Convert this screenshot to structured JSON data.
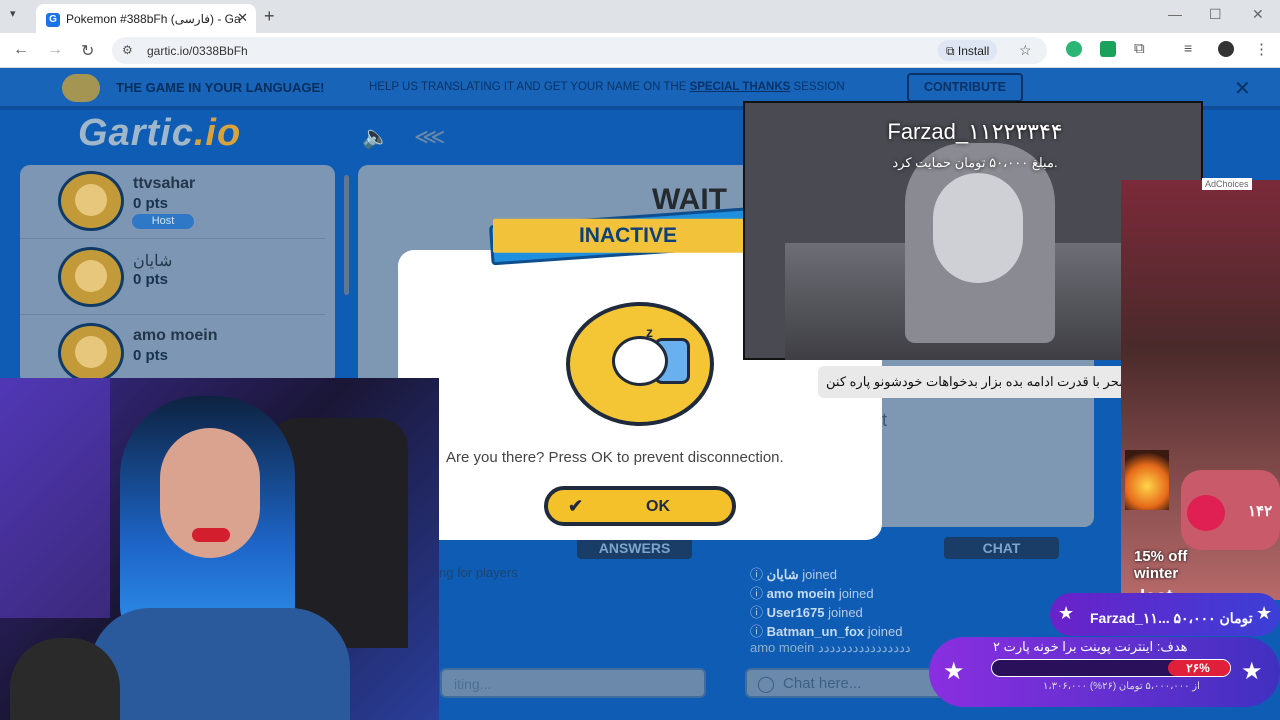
{
  "browser": {
    "tab_title": "Pokemon #388bFh (فارسی) - Ga",
    "url": "gartic.io/0338BbFh",
    "install_label": "Install"
  },
  "banner": {
    "headline": "THE GAME IN YOUR LANGUAGE!",
    "help_prefix": "HELP US TRANSLATING IT AND GET YOUR NAME ON THE",
    "help_link": "SPECIAL THANKS",
    "help_suffix": "SESSION",
    "contribute": "CONTRIBUTE"
  },
  "players": [
    {
      "name": "ttvsahar",
      "pts": "0 pts",
      "badge": "Host"
    },
    {
      "name": "شایان",
      "pts": "0 pts"
    },
    {
      "name": "amo moein",
      "pts": "0 pts"
    }
  ],
  "board": {
    "waiting": "WAIT"
  },
  "modal": {
    "title": "INACTIVE",
    "message": "Are you there? Press OK to prevent disconnection.",
    "ok": "OK"
  },
  "answers": {
    "tab": "ANSWERS",
    "status": "ng for players",
    "placeholder": "iting..."
  },
  "chat": {
    "tab": "CHAT",
    "placeholder": "Chat here...",
    "lines": [
      {
        "user": "شایان",
        "action": "joined"
      },
      {
        "user": "amo moein",
        "action": "joined"
      },
      {
        "user": "User1675",
        "action": "joined"
      },
      {
        "user": "Batman_un_fox",
        "action": "joined"
      },
      {
        "user": "amo moein",
        "action": "دددددددددددددددد"
      }
    ]
  },
  "alert": {
    "name": "Farzad_۱۱۲۲۳۳۴۴",
    "amount": "مبلغ ۵۰،۰۰۰ تومان حمایت کرد.",
    "subtitle": "سحر با قدرت ادامه بده بزار بدخواهات خودشونو پاره کنن"
  },
  "ad": {
    "choices": "AdChoices",
    "text1": "15% off",
    "text2": "winter",
    "text3": "last"
  },
  "overlay": {
    "viewers": "۱۴۲",
    "donation": "Farzad_۱۱... ۵۰،۰۰۰ تومان",
    "goal_title": "هدف: اینترنت پوینت برا خونه پارت ۲",
    "goal_percent": "۲۶%",
    "goal_progress": 0.26,
    "goal_sub": "۱،۳۰۶،۰۰۰ از ۵،۰۰۰،۰۰۰ تومان (۲۶%)"
  }
}
